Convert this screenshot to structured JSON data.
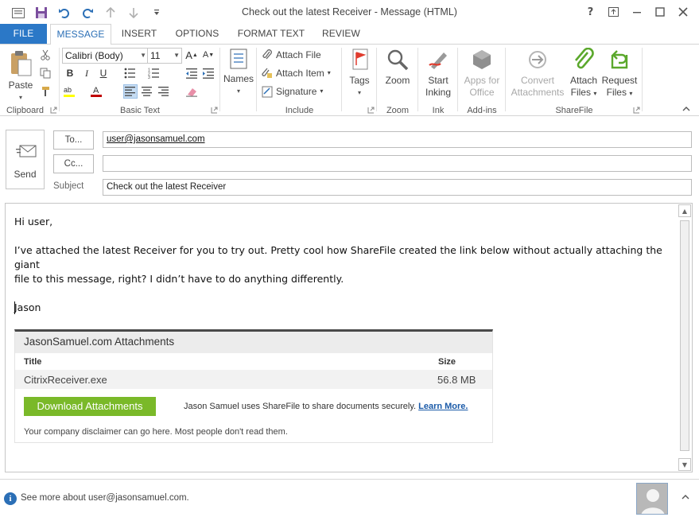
{
  "window": {
    "title": "Check out the latest Receiver - Message (HTML)",
    "help": "?"
  },
  "tabs": [
    {
      "label": "FILE"
    },
    {
      "label": "MESSAGE"
    },
    {
      "label": "INSERT"
    },
    {
      "label": "OPTIONS"
    },
    {
      "label": "FORMAT TEXT"
    },
    {
      "label": "REVIEW"
    }
  ],
  "ribbon": {
    "clipboard": {
      "label": "Clipboard",
      "paste": "Paste"
    },
    "basic_text": {
      "label": "Basic Text",
      "font": "Calibri (Body)",
      "size": "11",
      "bold": "B",
      "italic": "I",
      "underline": "U",
      "grow": "A",
      "shrink": "A"
    },
    "names": {
      "label": "Names"
    },
    "include": {
      "label": "Include",
      "attach_file": "Attach File",
      "attach_item": "Attach Item",
      "signature": "Signature"
    },
    "tags": {
      "label": "Tags"
    },
    "zoom": {
      "label": "Zoom",
      "zoom_btn": "Zoom"
    },
    "ink": {
      "label": "Ink",
      "start_inking_1": "Start",
      "start_inking_2": "Inking"
    },
    "addins": {
      "label": "Add-ins",
      "apps_1": "Apps for",
      "apps_2": "Office"
    },
    "sharefile": {
      "label": "ShareFile",
      "convert_1": "Convert",
      "convert_2": "Attachments",
      "attach_files_1": "Attach",
      "attach_files_2": "Files",
      "request_files_1": "Request",
      "request_files_2": "Files"
    }
  },
  "colors": {
    "accent": "#2b78c7",
    "font_highlight": "#ffff00",
    "font_color": "#c00000",
    "download_button": "#7ab929"
  },
  "header": {
    "send": "Send",
    "to_button": "To...",
    "cc_button": "Cc...",
    "to_value": "user@jasonsamuel.com",
    "cc_value": "",
    "subject_label": "Subject",
    "subject_value": "Check out the latest Receiver"
  },
  "body": {
    "greeting": "Hi user,",
    "paragraph_1": "I’ve attached the latest Receiver for you to try out.  Pretty cool how ShareFile created the link below without actually attaching the giant",
    "paragraph_2": "file to this message, right?  I didn’t have to do anything differently.",
    "signoff": "Jason"
  },
  "attachment_card": {
    "title": "JasonSamuel.com Attachments",
    "col_title": "Title",
    "col_size": "Size",
    "files": [
      {
        "name": "CitrixReceiver.exe",
        "size": "56.8 MB"
      }
    ],
    "download_label": "Download Attachments",
    "note": "Jason Samuel uses ShareFile to share documents securely.",
    "learn_more": "Learn More.",
    "disclaimer": "Your company disclaimer can go here.  Most people don't read them."
  },
  "people_pane": {
    "text": "See more about user@jasonsamuel.com."
  }
}
